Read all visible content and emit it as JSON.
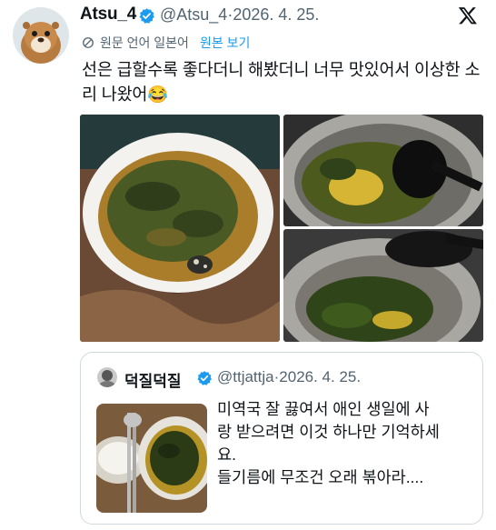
{
  "tweet": {
    "author_name": "Atsu_4",
    "author_handle": "@Atsu_4",
    "separator": "·",
    "date": "2026. 4. 25.",
    "translation_note": "원문 언어 일본어",
    "show_original": "원본 보기",
    "text": "선은 급할수록 좋다더니 해봤더니 너무 맛있어서 이상한 소리 나왔어😂",
    "icons": [
      "avatar-otter",
      "verified-badge-icon",
      "x-logo-icon",
      "translate-icon"
    ]
  },
  "quote": {
    "author_name": "덕질덕질",
    "author_handle": "@ttjattja",
    "separator": "·",
    "date": "2026. 4. 25.",
    "text_lines": [
      "미역국 잘 끓여서 애인 생일에 사",
      "랑 받으려면 이것 하나만 기억하세",
      "요.",
      "들기름에 무조건 오래 볶아라...."
    ]
  },
  "colors": {
    "accent": "#1d9bf0",
    "secondary_text": "#536471",
    "border": "#cfd9de"
  }
}
